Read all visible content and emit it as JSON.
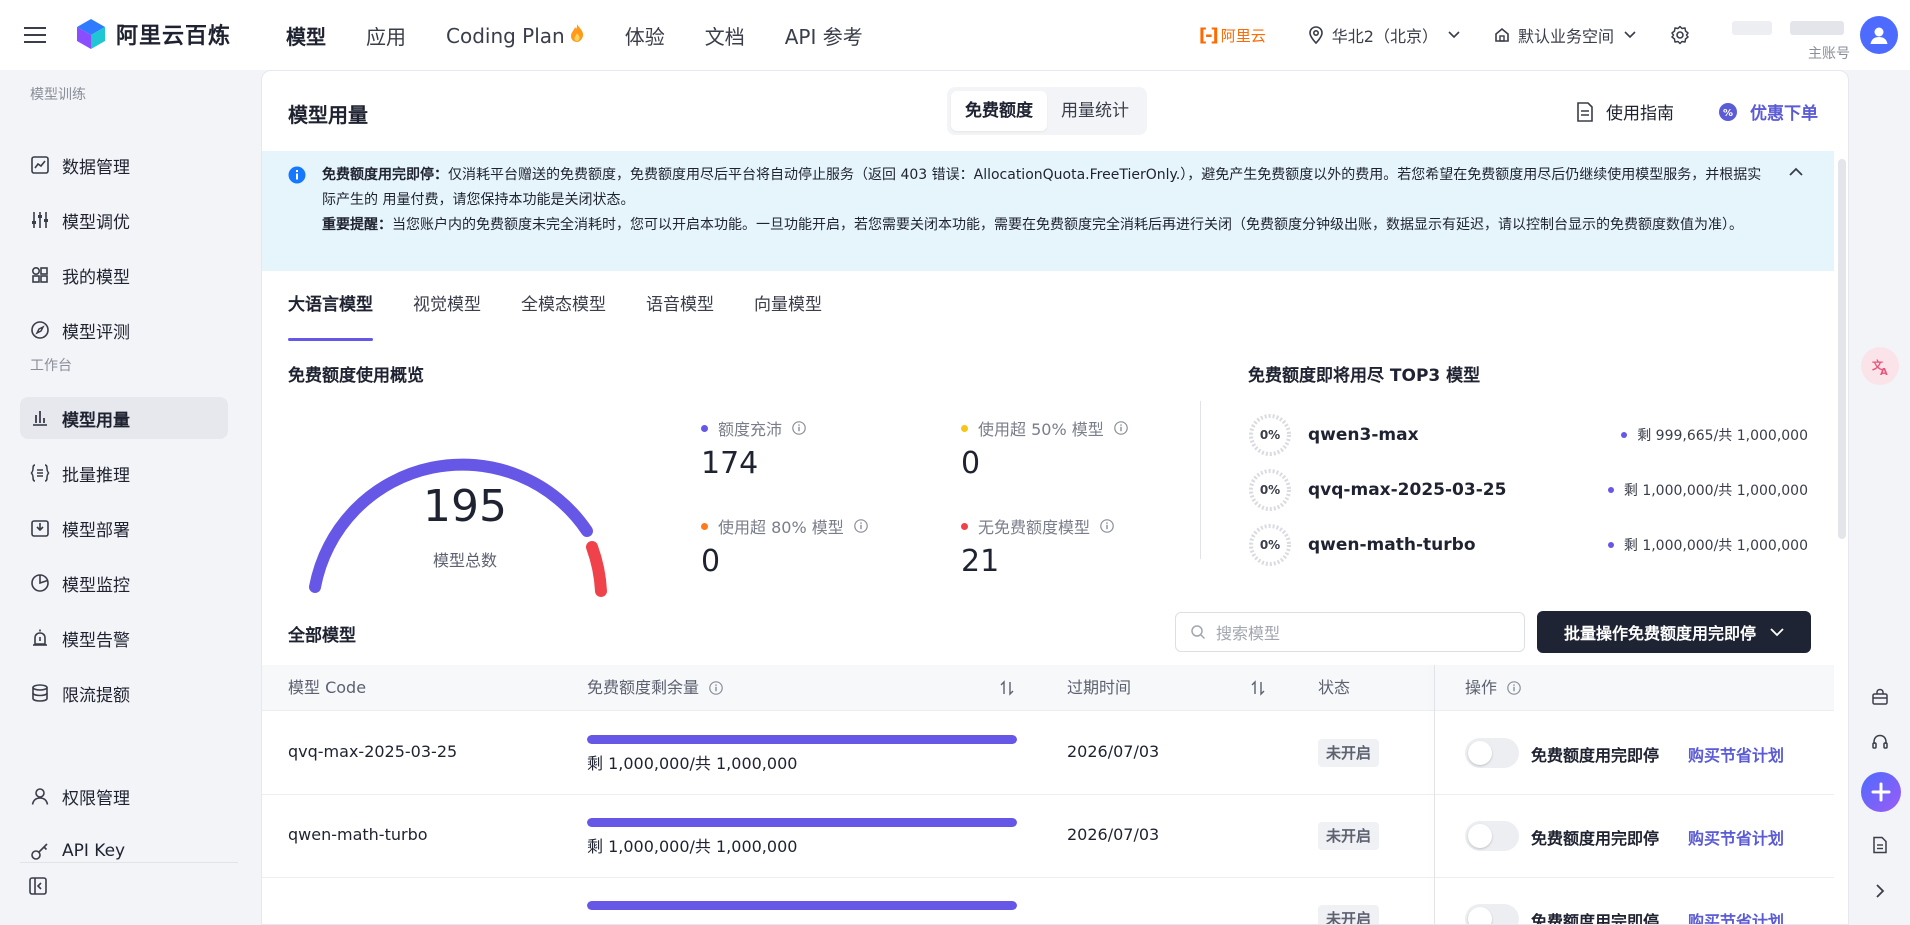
{
  "app": {
    "brand": "阿里云百炼",
    "nav": [
      {
        "label": "模型",
        "active": true
      },
      {
        "label": "应用"
      },
      {
        "label": "Coding Plan"
      },
      {
        "label": "体验"
      },
      {
        "label": "文档"
      },
      {
        "label": "API 参考"
      }
    ],
    "aliyun_label": "阿里云",
    "region": "华北2（北京）",
    "workspace": "默认业务空间",
    "account_label": "主账号"
  },
  "sidebar": {
    "sections": [
      {
        "title": "模型训练",
        "items": [
          "数据管理",
          "模型调优",
          "我的模型",
          "模型评测"
        ]
      },
      {
        "title": "工作台",
        "items": [
          "模型用量",
          "批量推理",
          "模型部署",
          "模型监控",
          "模型告警",
          "限流提额"
        ]
      }
    ],
    "bottom_items": [
      "权限管理",
      "API Key"
    ],
    "active": "模型用量"
  },
  "main": {
    "title": "模型用量",
    "segments": [
      "免费额度",
      "用量统计"
    ],
    "guide_label": "使用指南",
    "coupon_label": "优惠下单",
    "notice": {
      "line1_bold": "免费额度用完即停：",
      "line1": "仅消耗平台赠送的免费额度，免费额度用尽后平台将自动停止服务（返回 403 错误：AllocationQuota.FreeTierOnly.），避免产生免费额度以外的费用。若您希望在免费额度用尽后仍继续使用模型服务，并根据实际产生的 用量付费，请您保持本功能是关闭状态。",
      "line2_bold": "重要提醒：",
      "line2": "当您账户内的免费额度未完全消耗时，您可以开启本功能。一旦功能开启，若您需要关闭本功能，需要在免费额度完全消耗后再进行关闭（免费额度分钟级出账，数据显示有延迟，请以控制台显示的免费额度数值为准）。"
    },
    "tabs": [
      "大语言模型",
      "视觉模型",
      "全模态模型",
      "语音模型",
      "向量模型"
    ],
    "overview_title": "免费额度使用概览",
    "gauge": {
      "total": "195",
      "label": "模型总数"
    },
    "stats": [
      {
        "label": "额度充沛",
        "value": "174",
        "color": "#6657e6"
      },
      {
        "label": "使用超 50% 模型",
        "value": "0",
        "color": "#f5c518"
      },
      {
        "label": "使用超 80% 模型",
        "value": "0",
        "color": "#ff7a1a"
      },
      {
        "label": "无免费额度模型",
        "value": "21",
        "color": "#f0424a"
      }
    ],
    "top3_title": "免费额度即将用尽 TOP3 模型",
    "top3": [
      {
        "pct": "0%",
        "name": "qwen3-max",
        "remaining": "剩 999,665/共 1,000,000"
      },
      {
        "pct": "0%",
        "name": "qvq-max-2025-03-25",
        "remaining": "剩 1,000,000/共 1,000,000"
      },
      {
        "pct": "0%",
        "name": "qwen-math-turbo",
        "remaining": "剩 1,000,000/共 1,000,000"
      }
    ],
    "all_models_title": "全部模型",
    "search_placeholder": "搜索模型",
    "batch_label": "批量操作免费额度用完即停",
    "table": {
      "headers": [
        "模型 Code",
        "免费额度剩余量",
        "过期时间",
        "状态",
        "操作"
      ],
      "rows": [
        {
          "code": "qvq-max-2025-03-25",
          "remaining": "剩 1,000,000/共 1,000,000",
          "fraction": 1.0,
          "expire": "2026/07/03",
          "status": "未开启",
          "action_label": "免费额度用完即停",
          "buy": "购买节省计划"
        },
        {
          "code": "qwen-math-turbo",
          "remaining": "剩 1,000,000/共 1,000,000",
          "fraction": 1.0,
          "expire": "2026/07/03",
          "status": "未开启",
          "action_label": "免费额度用完即停",
          "buy": "购买节省计划"
        },
        {
          "code": "",
          "remaining": "",
          "fraction": 1.0,
          "expire": "",
          "status": "未开启",
          "action_label": "免费额度用完即停",
          "buy": "购买节省计划"
        }
      ]
    }
  }
}
